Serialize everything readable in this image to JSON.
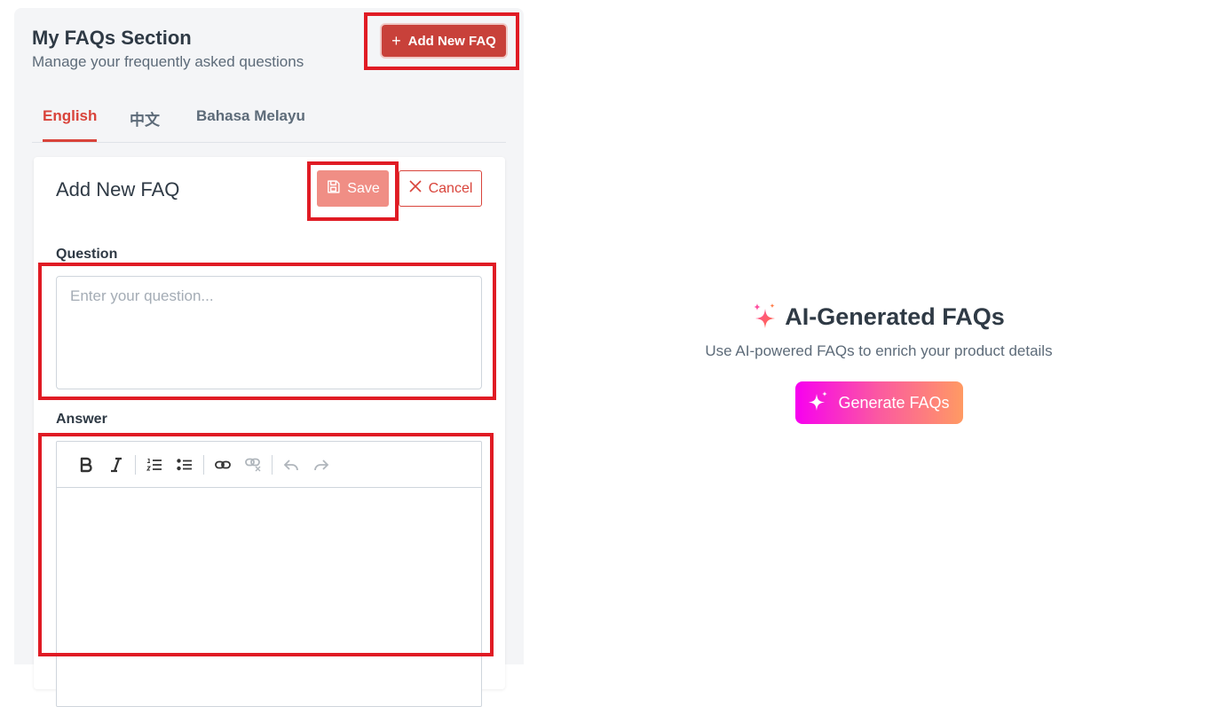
{
  "header": {
    "title": "My FAQs Section",
    "subtitle": "Manage your frequently asked questions",
    "add_button_label": "Add New FAQ"
  },
  "tabs": [
    {
      "label": "English",
      "active": true
    },
    {
      "label": "中文",
      "active": false
    },
    {
      "label": "Bahasa Melayu",
      "active": false
    }
  ],
  "form": {
    "title": "Add New FAQ",
    "save_label": "Save",
    "cancel_label": "Cancel",
    "question_label": "Question",
    "question_placeholder": "Enter your question...",
    "question_value": "",
    "answer_label": "Answer",
    "answer_value": "",
    "toolbar": [
      "bold-icon",
      "italic-icon",
      "ordered-list-icon",
      "bullet-list-icon",
      "link-icon",
      "unlink-icon",
      "undo-icon",
      "redo-icon"
    ]
  },
  "ai": {
    "title": "AI-Generated FAQs",
    "subtitle": "Use AI-powered FAQs to enrich your product details",
    "button_label": "Generate FAQs"
  },
  "colors": {
    "primary": "#c8413a",
    "save_disabled": "#f08e85",
    "active_tab": "#d9443b",
    "highlight": "#e01b24",
    "gradient_start": "#f700f0",
    "gradient_end": "#ff9a63"
  }
}
